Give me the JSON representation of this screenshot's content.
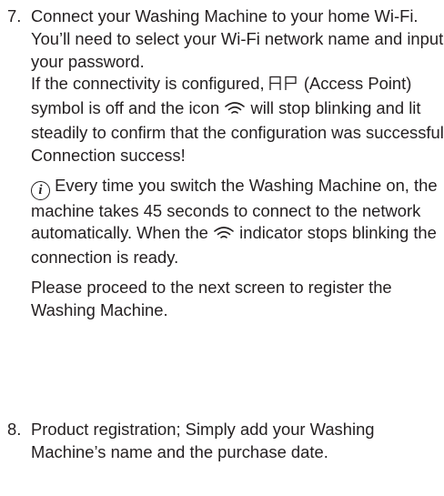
{
  "step7": {
    "number": "7.",
    "line1": "Connect your Washing Machine to your home Wi-Fi.",
    "line2": "You’ll need to select your Wi-Fi network name and input your password.",
    "line3_a": "If the connectivity is configured,",
    "ap_symbol_icon": "AP-segment-display-icon",
    "line3_b": "(Access Point) symbol is off and the icon",
    "wifi_icon": "wifi-icon",
    "line3_c": "will stop blinking and lit steadily to confirm that the configuration was successful",
    "line4": "Connection success!",
    "note_icon": "info-icon",
    "note_a": "Every time you switch the Washing Machine on, the machine takes 45 seconds to connect to the network automatically. When the",
    "note_b": "indicator stops blinking the connection is ready.",
    "proceed": "Please proceed to the next screen to register the Washing Machine."
  },
  "step8": {
    "number": "8.",
    "text": "Product registration; Simply add your Washing Machine’s name and the purchase date."
  }
}
